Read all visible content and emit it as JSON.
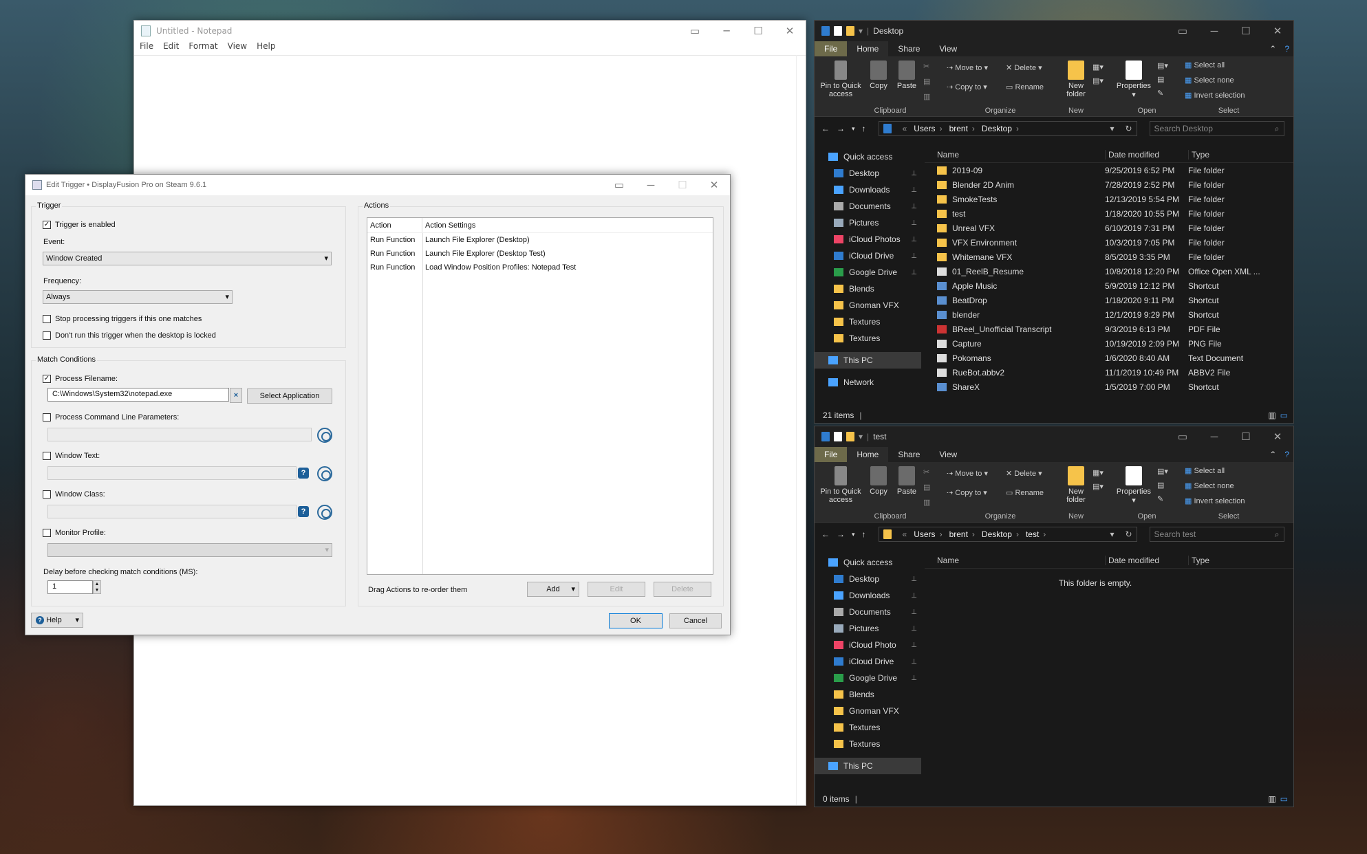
{
  "notepad": {
    "title": "Untitled - Notepad",
    "menu": [
      "File",
      "Edit",
      "Format",
      "View",
      "Help"
    ]
  },
  "dialog": {
    "title": "Edit Trigger • DisplayFusion Pro on Steam 9.6.1",
    "trigger_group": "Trigger",
    "trigger_enabled": "Trigger is enabled",
    "event_label": "Event:",
    "event_value": "Window Created",
    "frequency_label": "Frequency:",
    "frequency_value": "Always",
    "stop_processing": "Stop processing triggers if this one matches",
    "dont_run_locked": "Don't run this trigger when the desktop is locked",
    "match_group": "Match Conditions",
    "process_filename": "Process Filename:",
    "process_filename_value": "C:\\Windows\\System32\\notepad.exe",
    "select_application": "Select Application",
    "cmdline": "Process Command Line Parameters:",
    "window_text": "Window Text:",
    "window_class": "Window Class:",
    "monitor_profile": "Monitor Profile:",
    "delay_label": "Delay before checking match conditions (MS):",
    "delay_value": "1",
    "help": "Help",
    "actions_group": "Actions",
    "col_action": "Action",
    "col_settings": "Action Settings",
    "actions": [
      {
        "action": "Run Function",
        "settings": "Launch File Explorer (Desktop)"
      },
      {
        "action": "Run Function",
        "settings": "Launch File Explorer (Desktop Test)"
      },
      {
        "action": "Run Function",
        "settings": "Load Window Position Profiles: Notepad Test"
      }
    ],
    "drag_hint": "Drag Actions to re-order them",
    "add": "Add",
    "edit": "Edit",
    "delete": "Delete",
    "ok": "OK",
    "cancel": "Cancel"
  },
  "ribbon": {
    "file": "File",
    "home": "Home",
    "share": "Share",
    "view": "View",
    "pin": "Pin to Quick access",
    "copy": "Copy",
    "paste": "Paste",
    "move_to": "Move to",
    "copy_to": "Copy to",
    "delete": "Delete",
    "rename": "Rename",
    "new_folder": "New folder",
    "properties": "Properties",
    "select_all": "Select all",
    "select_none": "Select none",
    "invert": "Invert selection",
    "g_clipboard": "Clipboard",
    "g_organize": "Organize",
    "g_new": "New",
    "g_open": "Open",
    "g_select": "Select"
  },
  "explorer1": {
    "title": "Desktop",
    "crumbs": [
      "Users",
      "brent",
      "Desktop"
    ],
    "search": "Search Desktop",
    "col_name": "Name",
    "col_date": "Date modified",
    "col_type": "Type",
    "nav": [
      {
        "label": "Quick access"
      },
      {
        "label": "Desktop",
        "pin": true
      },
      {
        "label": "Downloads",
        "pin": true
      },
      {
        "label": "Documents",
        "pin": true
      },
      {
        "label": "Pictures",
        "pin": true
      },
      {
        "label": "iCloud Photos",
        "pin": true
      },
      {
        "label": "iCloud Drive",
        "pin": true
      },
      {
        "label": "Google Drive",
        "pin": true
      },
      {
        "label": "Blends"
      },
      {
        "label": "Gnoman VFX"
      },
      {
        "label": "Textures"
      },
      {
        "label": "Textures"
      },
      {
        "label": "This PC"
      },
      {
        "label": "Network"
      }
    ],
    "files": [
      {
        "name": "2019-09",
        "date": "9/25/2019 6:52 PM",
        "type": "File folder"
      },
      {
        "name": "Blender 2D Anim",
        "date": "7/28/2019 2:52 PM",
        "type": "File folder"
      },
      {
        "name": "SmokeTests",
        "date": "12/13/2019 5:54 PM",
        "type": "File folder"
      },
      {
        "name": "test",
        "date": "1/18/2020 10:55 PM",
        "type": "File folder"
      },
      {
        "name": "Unreal VFX",
        "date": "6/10/2019 7:31 PM",
        "type": "File folder"
      },
      {
        "name": "VFX Environment",
        "date": "10/3/2019 7:05 PM",
        "type": "File folder"
      },
      {
        "name": "Whitemane VFX",
        "date": "8/5/2019 3:35 PM",
        "type": "File folder"
      },
      {
        "name": "01_ReelB_Resume",
        "date": "10/8/2018 12:20 PM",
        "type": "Office Open XML ..."
      },
      {
        "name": "Apple Music",
        "date": "5/9/2019 12:12 PM",
        "type": "Shortcut"
      },
      {
        "name": "BeatDrop",
        "date": "1/18/2020 9:11 PM",
        "type": "Shortcut"
      },
      {
        "name": "blender",
        "date": "12/1/2019 9:29 PM",
        "type": "Shortcut"
      },
      {
        "name": "BReel_Unofficial Transcript",
        "date": "9/3/2019 6:13 PM",
        "type": "PDF File"
      },
      {
        "name": "Capture",
        "date": "10/19/2019 2:09 PM",
        "type": "PNG File"
      },
      {
        "name": "Pokomans",
        "date": "1/6/2020 8:40 AM",
        "type": "Text Document"
      },
      {
        "name": "RueBot.abbv2",
        "date": "11/1/2019 10:49 PM",
        "type": "ABBV2 File"
      },
      {
        "name": "ShareX",
        "date": "1/5/2019 7:00 PM",
        "type": "Shortcut"
      }
    ],
    "status": "21 items"
  },
  "explorer2": {
    "title": "test",
    "crumbs": [
      "Users",
      "brent",
      "Desktop",
      "test"
    ],
    "search": "Search test",
    "col_name": "Name",
    "col_date": "Date modified",
    "col_type": "Type",
    "empty": "This folder is empty.",
    "nav": [
      {
        "label": "Quick access"
      },
      {
        "label": "Desktop",
        "pin": true
      },
      {
        "label": "Downloads",
        "pin": true
      },
      {
        "label": "Documents",
        "pin": true
      },
      {
        "label": "Pictures",
        "pin": true
      },
      {
        "label": "iCloud Photo",
        "pin": true
      },
      {
        "label": "iCloud Drive",
        "pin": true
      },
      {
        "label": "Google Drive",
        "pin": true
      },
      {
        "label": "Blends"
      },
      {
        "label": "Gnoman VFX"
      },
      {
        "label": "Textures"
      },
      {
        "label": "Textures"
      },
      {
        "label": "This PC"
      }
    ],
    "status": "0 items"
  }
}
